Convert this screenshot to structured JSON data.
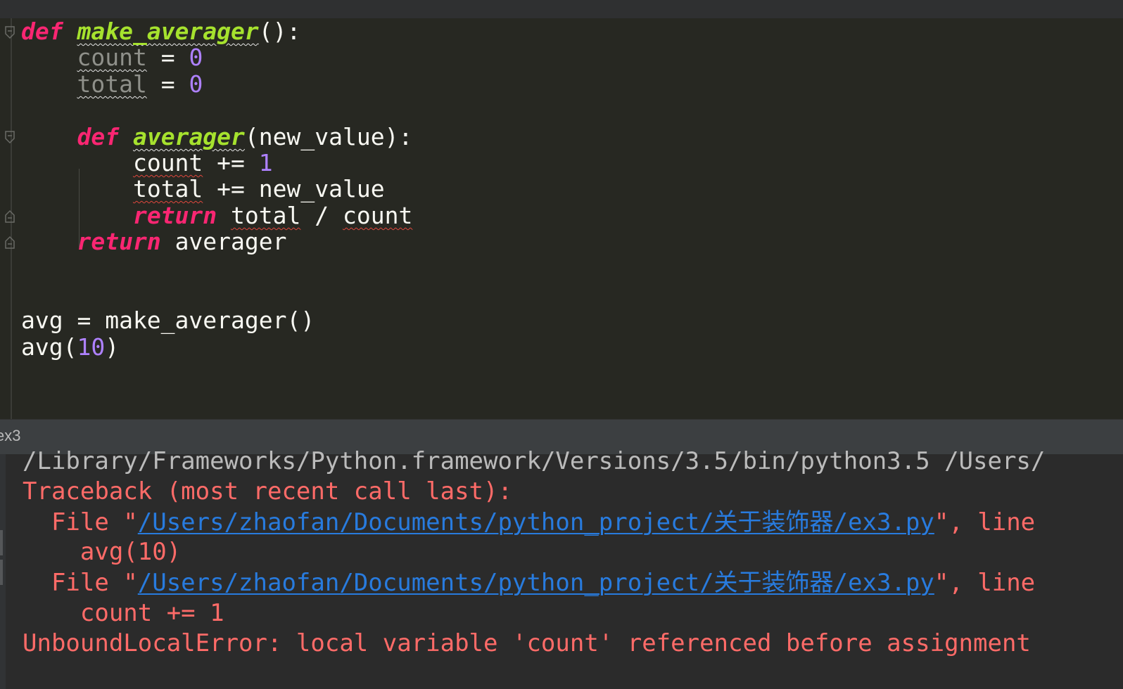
{
  "editor": {
    "lines": [
      {
        "segments": [
          {
            "text": "def",
            "cls": "kw"
          },
          {
            "text": " "
          },
          {
            "text": "make_averager",
            "cls": "fn sq"
          },
          {
            "text": "():"
          }
        ]
      },
      {
        "segments": [
          {
            "text": "    "
          },
          {
            "text": "count",
            "cls": "dim sq"
          },
          {
            "text": " = "
          },
          {
            "text": "0",
            "cls": "num"
          }
        ]
      },
      {
        "segments": [
          {
            "text": "    "
          },
          {
            "text": "total",
            "cls": "dim sq"
          },
          {
            "text": " = "
          },
          {
            "text": "0",
            "cls": "num"
          }
        ]
      },
      {
        "segments": []
      },
      {
        "segments": [
          {
            "text": "    "
          },
          {
            "text": "def",
            "cls": "kw"
          },
          {
            "text": " "
          },
          {
            "text": "averager",
            "cls": "fn sq"
          },
          {
            "text": "(new_value):"
          }
        ]
      },
      {
        "segments": [
          {
            "text": "        "
          },
          {
            "text": "count",
            "cls": "sq-red"
          },
          {
            "text": " += "
          },
          {
            "text": "1",
            "cls": "num"
          }
        ]
      },
      {
        "segments": [
          {
            "text": "        "
          },
          {
            "text": "total",
            "cls": "sq-red"
          },
          {
            "text": " += new_value"
          }
        ]
      },
      {
        "segments": [
          {
            "text": "        "
          },
          {
            "text": "return",
            "cls": "kw"
          },
          {
            "text": " "
          },
          {
            "text": "total",
            "cls": "sq-red"
          },
          {
            "text": " / "
          },
          {
            "text": "count",
            "cls": "sq-red"
          }
        ]
      },
      {
        "segments": [
          {
            "text": "    "
          },
          {
            "text": "return",
            "cls": "kw"
          },
          {
            "text": " averager"
          }
        ]
      },
      {
        "segments": []
      },
      {
        "segments": []
      },
      {
        "segments": [
          {
            "text": "avg = make_averager()"
          }
        ]
      },
      {
        "segments": [
          {
            "text": "avg("
          },
          {
            "text": "10",
            "cls": "num"
          },
          {
            "text": ")"
          }
        ]
      }
    ]
  },
  "run_panel": {
    "title": "ex3"
  },
  "console": {
    "command": "/Library/Frameworks/Python.framework/Versions/3.5/bin/python3.5 /Users/",
    "traceback_header": "Traceback (most recent call last):",
    "frames": [
      {
        "prefix": "  File \"",
        "path": "/Users/zhaofan/Documents/python_project/关于装饰器/ex3.py",
        "suffix": "\", line",
        "code": "    avg(10)"
      },
      {
        "prefix": "  File \"",
        "path": "/Users/zhaofan/Documents/python_project/关于装饰器/ex3.py",
        "suffix": "\", line",
        "code": "    count += 1"
      }
    ],
    "error": "UnboundLocalError: local variable 'count' referenced before assignment"
  },
  "colors": {
    "editor_bg": "#272822",
    "keyword": "#f92672",
    "function": "#a6e22e",
    "number": "#ae81ff",
    "console_error": "#ff6b68",
    "console_link": "#287bde"
  }
}
